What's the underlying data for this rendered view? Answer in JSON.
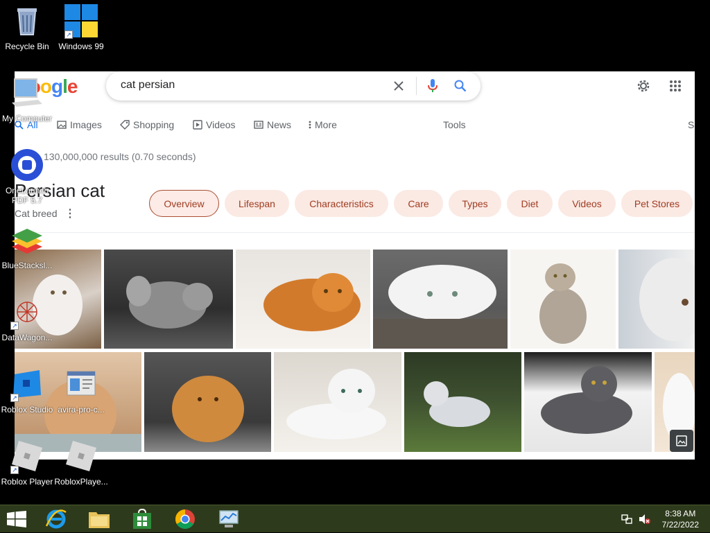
{
  "desktop": {
    "icons": [
      {
        "label": "Recycle Bin"
      },
      {
        "label": "Windows 99"
      },
      {
        "label": "My Computer"
      },
      {
        "label": "OneLaunch PDF 5.7"
      },
      {
        "label": "BlueStacksl..."
      },
      {
        "label": "DataWagon..."
      },
      {
        "label": "Roblox Studio"
      },
      {
        "label": "avira-pro-c..."
      },
      {
        "label": "Roblox Player"
      },
      {
        "label": "RobloxPlaye..."
      }
    ]
  },
  "browser": {
    "logo": "Google",
    "search": {
      "query": "cat persian"
    },
    "tabs": [
      {
        "label": "All",
        "icon": "search-icon"
      },
      {
        "label": "Images",
        "icon": "image-icon"
      },
      {
        "label": "Shopping",
        "icon": "tag-icon"
      },
      {
        "label": "Videos",
        "icon": "play-icon"
      },
      {
        "label": "News",
        "icon": "news-icon"
      },
      {
        "label": "More",
        "icon": "more-vertical-icon"
      }
    ],
    "tools_label": "Tools",
    "edge_label": "S",
    "stats": "130,000,000 results (0.70 seconds)",
    "knowledge_panel": {
      "title": "Persian cat",
      "subtitle": "Cat breed",
      "chips": [
        "Overview",
        "Lifespan",
        "Characteristics",
        "Care",
        "Types",
        "Diet",
        "Videos",
        "Pet Stores"
      ]
    }
  },
  "taskbar": {
    "clock_time": "8:38 AM",
    "clock_date": "7/22/2022"
  },
  "colors": {
    "taskbar": "#2e3a1c",
    "chip_bg": "#fbe9e3",
    "chip_text": "#9e3c21",
    "google_blue": "#4285f4"
  }
}
